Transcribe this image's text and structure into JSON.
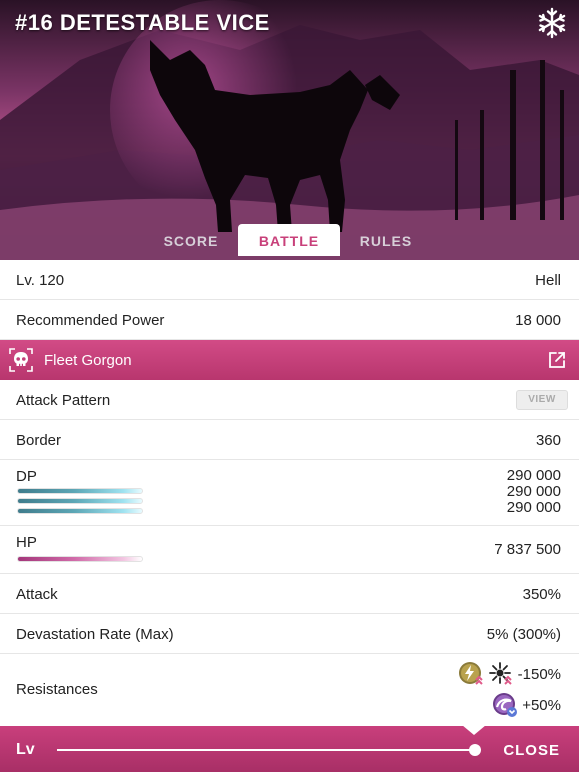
{
  "header": {
    "title": "#16 DETESTABLE VICE",
    "element_icon": "snowflake-icon"
  },
  "tabs": [
    {
      "label": "SCORE",
      "active": false
    },
    {
      "label": "BATTLE",
      "active": true
    },
    {
      "label": "RULES",
      "active": false
    }
  ],
  "rows": {
    "level": {
      "label": "Lv. 120",
      "value": "Hell"
    },
    "recommended_power": {
      "label": "Recommended Power",
      "value": "18 000"
    },
    "enemy": {
      "name": "Fleet Gorgon",
      "icon": "skull-icon",
      "link_icon": "external-link-icon"
    },
    "attack_pattern": {
      "label": "Attack Pattern",
      "button": "VIEW"
    },
    "border": {
      "label": "Border",
      "value": "360"
    },
    "dp": {
      "label": "DP",
      "values": [
        "290 000",
        "290 000",
        "290 000"
      ]
    },
    "hp": {
      "label": "HP",
      "value": "7 837 500"
    },
    "attack": {
      "label": "Attack",
      "value": "350%"
    },
    "devastation": {
      "label": "Devastation Rate (Max)",
      "value": "5% (300%)"
    },
    "resistances": {
      "label": "Resistances",
      "entries": [
        {
          "icons": [
            "lightning-up-icon",
            "burst-up-icon"
          ],
          "value": "-150%"
        },
        {
          "icons": [
            "wave-down-icon"
          ],
          "value": "+50%"
        }
      ]
    }
  },
  "footer": {
    "level_label": "Lv",
    "slider_value": 1.0,
    "close_label": "CLOSE"
  },
  "colors": {
    "accent": "#c8407a",
    "dp_bar": "#5ca6b5",
    "hp_bar": "#d06aa8"
  }
}
